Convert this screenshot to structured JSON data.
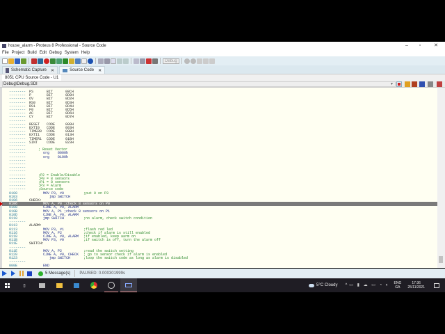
{
  "window": {
    "title": "house_alarm - Proteus 8 Professional - Source Code"
  },
  "menu": [
    "File",
    "Project",
    "Build",
    "Edit",
    "Debug",
    "System",
    "Help"
  ],
  "toolbar": {
    "config": "Debug"
  },
  "tabs": [
    {
      "label": "Schematic Capture"
    },
    {
      "label": "Source Code"
    }
  ],
  "subheader": "8051 CPU Source Code - U1",
  "path": "Debug\\Debug.SDI",
  "code_lines": [
    {
      "t": "sym",
      "a": "--------",
      "n": "PS",
      "ty": "BIT",
      "v": "08CH"
    },
    {
      "t": "sym",
      "a": "--------",
      "n": "P",
      "ty": "BIT",
      "v": "0D0H"
    },
    {
      "t": "sym",
      "a": "--------",
      "n": "OV",
      "ty": "BIT",
      "v": "0D2H"
    },
    {
      "t": "sym",
      "a": "--------",
      "n": "RS0",
      "ty": "BIT",
      "v": "0D3H"
    },
    {
      "t": "sym",
      "a": "--------",
      "n": "RS1",
      "ty": "BIT",
      "v": "0D4H"
    },
    {
      "t": "sym",
      "a": "--------",
      "n": "F0",
      "ty": "BIT",
      "v": "0D5H"
    },
    {
      "t": "sym",
      "a": "--------",
      "n": "AC",
      "ty": "BIT",
      "v": "0D6H"
    },
    {
      "t": "sym",
      "a": "--------",
      "n": "CY",
      "ty": "BIT",
      "v": "0D7H"
    },
    {
      "a": "--------"
    },
    {
      "t": "sym",
      "a": "--------",
      "n": "RESET",
      "ty": "CODE",
      "v": "000H"
    },
    {
      "t": "sym",
      "a": "--------",
      "n": "EXTI0",
      "ty": "CODE",
      "v": "003H"
    },
    {
      "t": "sym",
      "a": "--------",
      "n": "TIMER0",
      "ty": "CODE",
      "v": "00BH"
    },
    {
      "t": "sym",
      "a": "--------",
      "n": "EXTI1",
      "ty": "CODE",
      "v": "013H"
    },
    {
      "t": "sym",
      "a": "--------",
      "n": "TIMER1",
      "ty": "CODE",
      "v": "01BH"
    },
    {
      "t": "sym",
      "a": "--------",
      "n": "SINT",
      "ty": "CODE",
      "v": "023H"
    },
    {
      "a": "--------"
    },
    {
      "a": "--------",
      "cm2": "; Reset Vector"
    },
    {
      "a": "--------",
      "c": "org    0000h"
    },
    {
      "a": "--------",
      "c": "org    0100h"
    },
    {
      "a": "--------"
    },
    {
      "a": "--------"
    },
    {
      "a": "--------"
    },
    {
      "a": "--------"
    },
    {
      "a": "--------",
      "cm2": ";P2 = Enable/Disable"
    },
    {
      "a": "--------",
      "cm2": ";P0 = 8 sensors"
    },
    {
      "a": "--------",
      "cm2": ";P1 = 8 sensors"
    },
    {
      "a": "--------",
      "cm2": ";P3 = Alarm"
    },
    {
      "a": "--------",
      "cm2": ";Source code"
    },
    {
      "a": "0100",
      "c": "MOV P3, #0",
      "m": ";put 0 on P3"
    },
    {
      "a": "0103",
      "c": "   jmp SWITCH"
    },
    {
      "a": "0106",
      "l": "CHECK:"
    },
    {
      "a": "0106",
      "c": "MOV A, P0 ;check 8 sensors on P0",
      "hl": true
    },
    {
      "a": "0108",
      "c": "CJNE A, #0, ALARM"
    },
    {
      "a": "010B",
      "c": "MOV A, P1 ;check 8 sensors on P1"
    },
    {
      "a": "010D",
      "c": "CJNE A, #0, ALARM"
    },
    {
      "a": "0110",
      "c": "jmp SWITCH",
      "m": ";no alarm, check switch condition"
    },
    {
      "a": "--------"
    },
    {
      "a": "0113",
      "l": "ALARM:"
    },
    {
      "a": "0113",
      "c": "MOV P3, #1",
      "m": ";flash red led"
    },
    {
      "a": "0116",
      "c": "MOV A, P2",
      "m": ";check if alarm is still enabled"
    },
    {
      "a": "0118",
      "c": "CJNE A, #0, ALARM",
      "m": ";if enabled, keep aarm on"
    },
    {
      "a": "011B",
      "c": "MOV P3, #0",
      "m": ";if switch is off, turn the alarm off"
    },
    {
      "a": "011E",
      "l": "SWITCH:"
    },
    {
      "a": "--------"
    },
    {
      "a": "011E",
      "c": "MOV A, P2",
      "m": ";read the switch setting"
    },
    {
      "a": "0120",
      "c": "CJNE A, #0, CHECK",
      "m": "; go to sensor check if alarm is enabled"
    },
    {
      "a": "0123",
      "c": "   jmp SWITCH",
      "m": ";loop the switch code as long as alarm is disabled"
    },
    {
      "a": "--------"
    },
    {
      "a": "000E",
      "c": "END"
    }
  ],
  "status": {
    "messages": "5 Message(s)",
    "state": "PAUSED: 0.000301999s"
  },
  "taskbar": {
    "weather": "5°C  Cloudy",
    "lang1": "ENG",
    "lang2": "GA",
    "time": "17:36",
    "date": "25/11/2021"
  },
  "colors": {
    "highlight": "#7a7a7a",
    "editor_bg": "#fffff2",
    "comment": "#2c8a2c"
  }
}
